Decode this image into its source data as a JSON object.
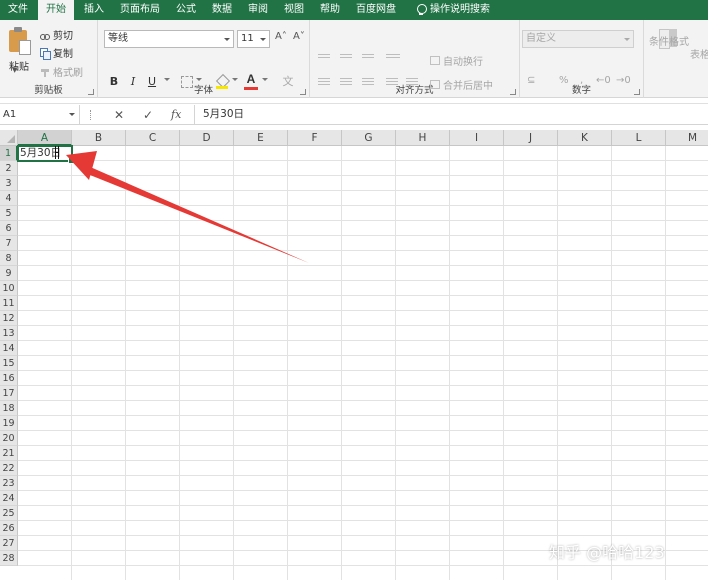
{
  "tabs": [
    {
      "label": "文件",
      "active": false
    },
    {
      "label": "开始",
      "active": true
    },
    {
      "label": "插入",
      "active": false
    },
    {
      "label": "页面布局",
      "active": false
    },
    {
      "label": "公式",
      "active": false
    },
    {
      "label": "数据",
      "active": false
    },
    {
      "label": "审阅",
      "active": false
    },
    {
      "label": "视图",
      "active": false
    },
    {
      "label": "帮助",
      "active": false
    },
    {
      "label": "百度网盘",
      "active": false
    }
  ],
  "search_tab": {
    "label": "操作说明搜索",
    "icon": "lightbulb-icon"
  },
  "clipboard": {
    "group_label": "剪贴板",
    "paste_label": "粘贴",
    "cut_label": "剪切",
    "copy_label": "复制",
    "format_painter_label": "格式刷"
  },
  "font": {
    "group_label": "字体",
    "font_name": "等线",
    "font_size": "11",
    "bold_label": "B",
    "italic_label": "I",
    "underline_label": "U",
    "font_color_label": "A",
    "grow_label": "A˄",
    "shrink_label": "A˅"
  },
  "alignment": {
    "group_label": "对齐方式",
    "wrap_label": "自动换行",
    "merge_label": "合并后居中"
  },
  "number": {
    "group_label": "数字",
    "format_value": "自定义",
    "percent_label": "%"
  },
  "styles": {
    "conditional_label": "条件格式",
    "table_label": "表格"
  },
  "formula_bar": {
    "name_box": "A1",
    "cancel_symbol": "✕",
    "enter_symbol": "✓",
    "fx_label": "fx",
    "content": "5月30日"
  },
  "columns": [
    "A",
    "B",
    "C",
    "D",
    "E",
    "F",
    "G",
    "H",
    "I",
    "J",
    "K",
    "L",
    "M"
  ],
  "rows": [
    "1",
    "2",
    "3",
    "4",
    "5",
    "6",
    "7",
    "8",
    "9",
    "10",
    "11",
    "12",
    "13",
    "14",
    "15",
    "16",
    "17",
    "18",
    "19",
    "20",
    "21",
    "22",
    "23",
    "24",
    "25",
    "26",
    "27",
    "28"
  ],
  "cell_a1": "5月30日",
  "watermark": "知乎 @哈哈123",
  "colors": {
    "accent": "#217346",
    "arrow": "#e53935"
  }
}
